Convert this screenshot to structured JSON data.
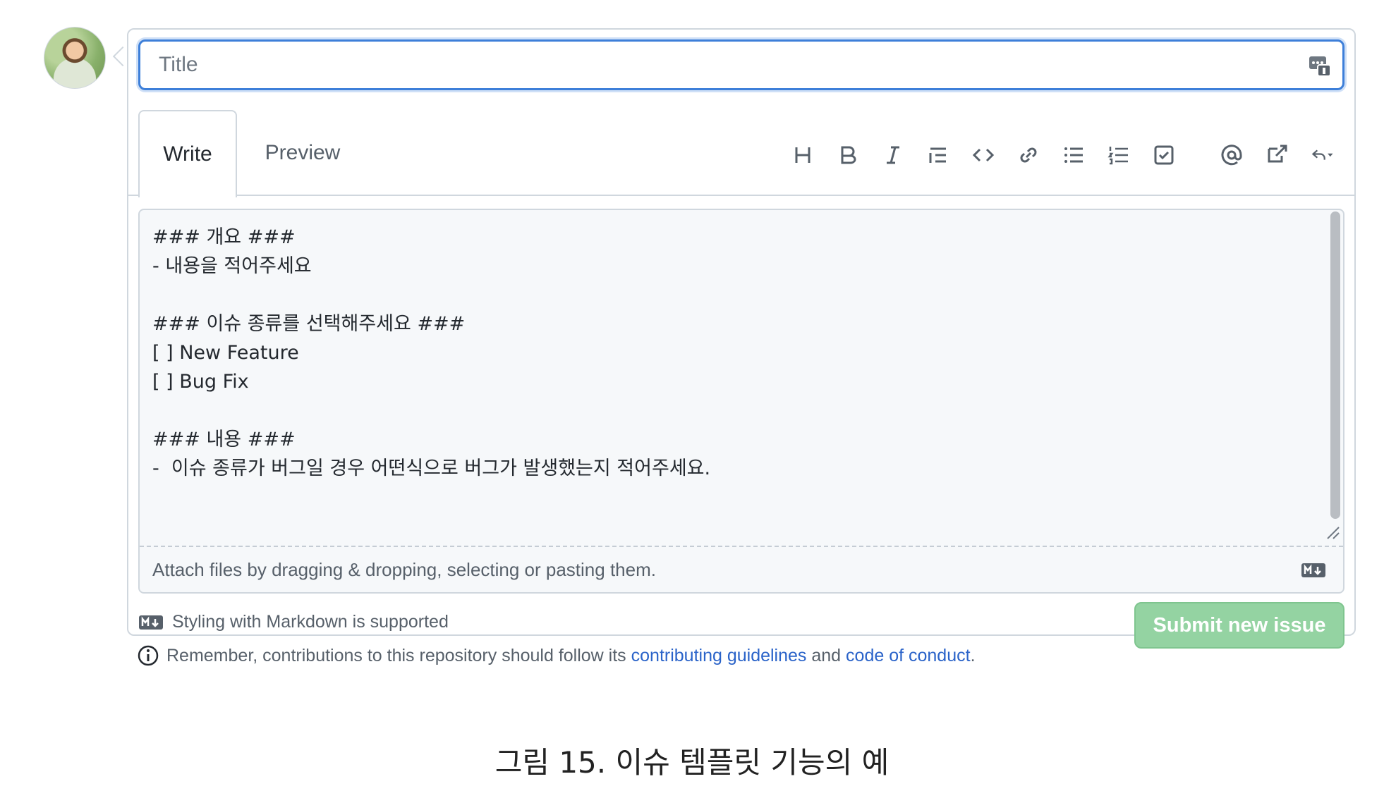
{
  "title_field": {
    "placeholder": "Title",
    "value": ""
  },
  "tabs": [
    {
      "label": "Write"
    },
    {
      "label": "Preview"
    }
  ],
  "toolbar": {
    "buttons": [
      {
        "name": "heading-icon"
      },
      {
        "name": "bold-icon"
      },
      {
        "name": "italic-icon"
      },
      {
        "name": "quote-icon"
      },
      {
        "name": "code-icon"
      },
      {
        "name": "link-icon"
      },
      {
        "name": "bulleted-list-icon"
      },
      {
        "name": "numbered-list-icon"
      },
      {
        "name": "task-list-icon"
      },
      {
        "name": "mention-icon"
      },
      {
        "name": "cross-reference-icon"
      },
      {
        "name": "saved-replies-icon"
      }
    ]
  },
  "editor": {
    "body": "### 개요 ###\n- 내용을 적어주세요\n\n### 이슈 종류를 선택해주세요 ###\n[ ] New Feature\n[ ] Bug Fix\n\n### 내용 ###\n-  이슈 종류가 버그일 경우 어떤식으로 버그가 발생했는지 적어주세요.",
    "attach_hint": "Attach files by dragging & dropping, selecting or pasting them."
  },
  "footer": {
    "markdown_note": "Styling with Markdown is supported",
    "submit_label": "Submit new issue"
  },
  "notice": {
    "prefix": "Remember, contributions to this repository should follow its",
    "link1": "contributing guidelines",
    "middle": "and",
    "link2": "code of conduct",
    "suffix": "."
  },
  "caption": "그림 15. 이슈 템플릿 기능의 예",
  "colors": {
    "accent": "#3d7fd9",
    "submit": "#94d3a2",
    "link": "#2a63c9"
  }
}
